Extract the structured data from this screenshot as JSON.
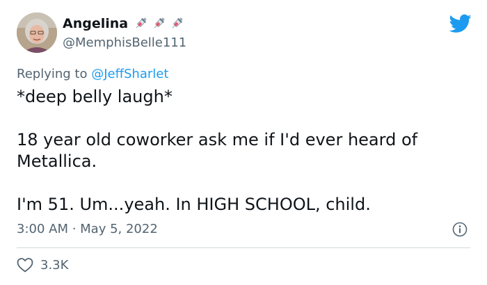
{
  "author": {
    "display_name": "Angelina",
    "name_emojis": [
      "syringe-emoji",
      "syringe-emoji",
      "syringe-emoji"
    ],
    "handle": "@MemphisBelle111"
  },
  "reply": {
    "prefix": "Replying to ",
    "mention": "@JeffSharlet"
  },
  "tweet": {
    "lines": [
      "*deep belly laugh*",
      "18 year old coworker ask me if I'd ever heard of Metallica.",
      "I'm 51. Um...yeah. In HIGH SCHOOL, child."
    ]
  },
  "meta": {
    "timestamp": "3:00 AM · May 5, 2022"
  },
  "stats": {
    "likes": "3.3K"
  },
  "colors": {
    "twitter_blue": "#1d9bf0",
    "secondary_text": "#536471",
    "divider": "#cfd9de"
  },
  "icons": {
    "brand": "twitter-bird-icon",
    "info": "info-icon",
    "like": "heart-icon"
  }
}
